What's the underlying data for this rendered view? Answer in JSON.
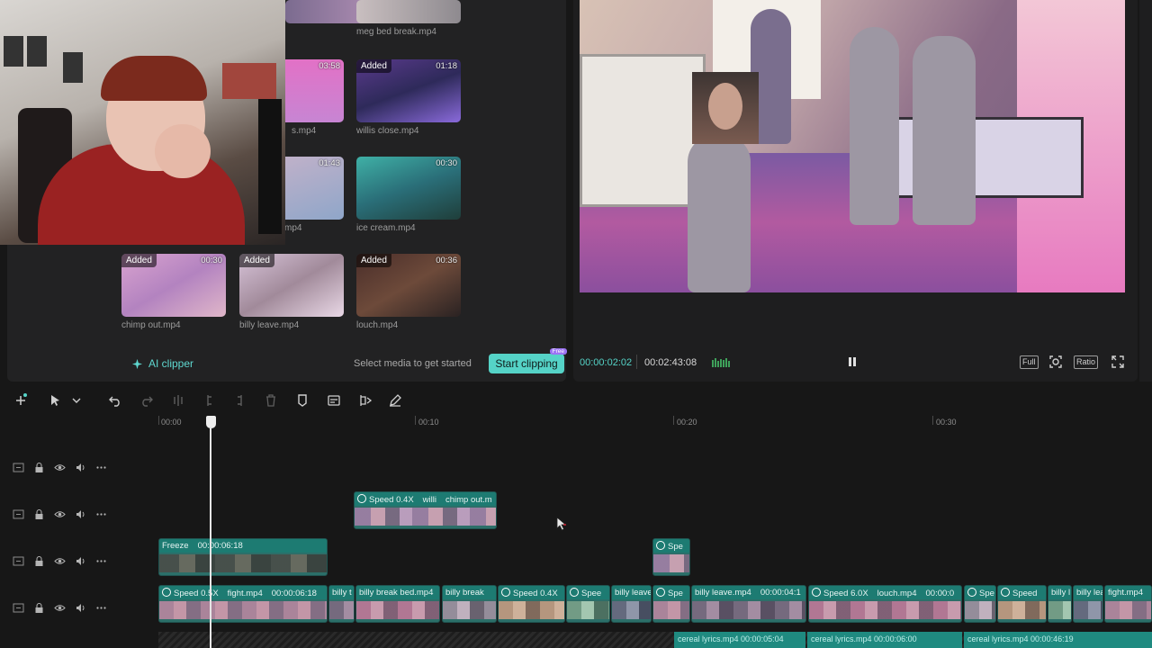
{
  "media": {
    "tiles": [
      {
        "name": "",
        "duration": "",
        "added": false
      },
      {
        "name": "meg bed break.mp4",
        "duration": "",
        "added": false
      },
      {
        "name": "s.mp4",
        "duration": "03:58",
        "added": false
      },
      {
        "name": "willis close.mp4",
        "duration": "01:18",
        "added": true
      },
      {
        "name": "mp4",
        "duration": "01:43",
        "added": false
      },
      {
        "name": "ice cream.mp4",
        "duration": "00:30",
        "added": false
      },
      {
        "name": "chimp out.mp4",
        "duration": "00:30",
        "added": true
      },
      {
        "name": "billy leave.mp4",
        "duration": "",
        "added": true
      },
      {
        "name": "louch.mp4",
        "duration": "00:36",
        "added": true
      }
    ],
    "added_label": "Added",
    "ai_clipper": "AI clipper",
    "hint": "Select media to get started",
    "start_clipping": "Start clipping",
    "free_tag": "Free"
  },
  "player": {
    "current_time": "00:00:02:02",
    "total_time": "00:02:43:08",
    "full_label": "Full",
    "ratio_label": "Ratio"
  },
  "timeline": {
    "ruler": [
      "00:00",
      "00:10",
      "00:20",
      "00:30"
    ],
    "clips_track2": [
      {
        "parts": [
          "Speed 0.4X",
          "willi",
          "chimp out.m"
        ]
      }
    ],
    "clips_track3": [
      {
        "parts": [
          "Freeze",
          "00:00:06:18"
        ]
      },
      {
        "parts": [
          "Spe"
        ]
      }
    ],
    "clips_main": [
      {
        "parts": [
          "Speed 0.5X",
          "fight.mp4",
          "00:00:06:18"
        ]
      },
      {
        "parts": [
          "billy t"
        ]
      },
      {
        "parts": [
          "billy break bed.mp4"
        ]
      },
      {
        "parts": [
          "billy break"
        ]
      },
      {
        "parts": [
          "Speed 0.4X"
        ]
      },
      {
        "parts": [
          "Spee"
        ]
      },
      {
        "parts": [
          "billy leave"
        ]
      },
      {
        "parts": [
          "Spe"
        ]
      },
      {
        "parts": [
          "billy leave.mp4",
          "00:00:04:1"
        ]
      },
      {
        "parts": [
          "Speed 6.0X",
          "louch.mp4",
          "00:00:0"
        ]
      },
      {
        "parts": [
          "Spe"
        ]
      },
      {
        "parts": [
          "Speed"
        ]
      },
      {
        "parts": [
          "billy l"
        ]
      },
      {
        "parts": [
          "billy lea"
        ]
      },
      {
        "parts": [
          "fight.mp4"
        ]
      }
    ],
    "audio_clips": [
      {
        "name": "cereal lyrics.mp4",
        "time": "00:00:05:04"
      },
      {
        "name": "cereal lyrics.mp4",
        "time": "00:00:06:00"
      },
      {
        "name": "cereal lyrics.mp4",
        "time": "00:00:46:19"
      }
    ]
  },
  "colors": {
    "accent": "#55d3c7",
    "clip": "#2c6f69",
    "free_tag": "#9c74f4"
  }
}
